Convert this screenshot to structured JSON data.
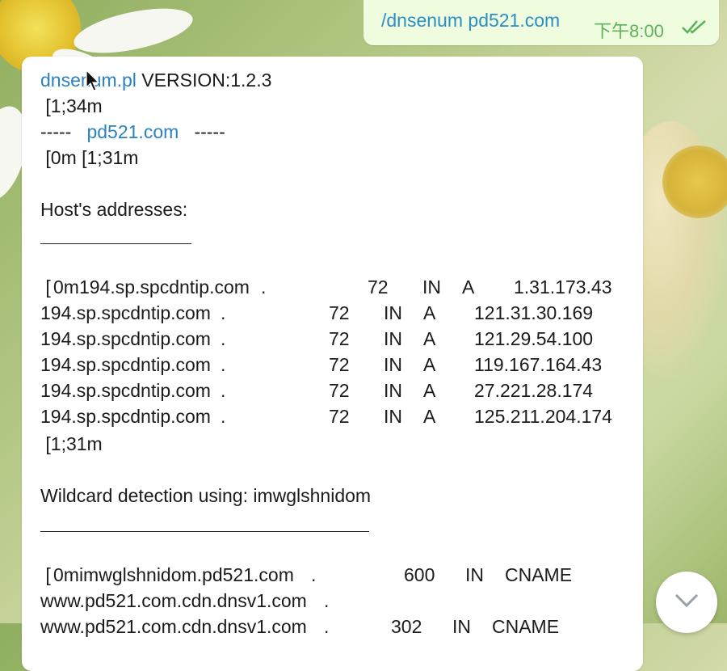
{
  "outgoing": {
    "text": "/dnsenum pd521.com",
    "time": "下午8:00",
    "status_icon": "double-check-icon"
  },
  "incoming": {
    "header_tool": "dnsenum.pl",
    "header_version": " VERSION:1.2.3",
    "line2": " [1;34m",
    "line3_prefix": "-----   ",
    "line3_domain": "pd521.com",
    "line3_suffix": "   -----",
    "line4": " [0m [1;31m",
    "hosts_heading": "Host's addresses:",
    "hosts_rule": "__________________",
    "host_rows": [
      {
        "prefix": " [",
        "host": "0m194.sp.spcdntip.com",
        "dot": ".",
        "ttl": "72",
        "cls": "IN",
        "type": "A",
        "ip": "1.31.173.43"
      },
      {
        "prefix": "",
        "host": "194.sp.spcdntip.com",
        "dot": ".",
        "ttl": "72",
        "cls": "IN",
        "type": "A",
        "ip": "121.31.30.169"
      },
      {
        "prefix": "",
        "host": "194.sp.spcdntip.com",
        "dot": ".",
        "ttl": "72",
        "cls": "IN",
        "type": "A",
        "ip": "121.29.54.100"
      },
      {
        "prefix": "",
        "host": "194.sp.spcdntip.com",
        "dot": ".",
        "ttl": "72",
        "cls": "IN",
        "type": "A",
        "ip": "119.167.164.43"
      },
      {
        "prefix": "",
        "host": "194.sp.spcdntip.com",
        "dot": ".",
        "ttl": "72",
        "cls": "IN",
        "type": "A",
        "ip": "27.221.28.174"
      },
      {
        "prefix": "",
        "host": "194.sp.spcdntip.com",
        "dot": ".",
        "ttl": "72",
        "cls": "IN",
        "type": "A",
        "ip": "125.211.204.174"
      }
    ],
    "after_hosts": " [1;31m",
    "wildcard_heading": "Wildcard detection using: imwglshnidom",
    "wildcard_rule": "_______________________________________",
    "wildcard_rows": [
      {
        "prefix": " [",
        "host": "0mimwglshnidom.pd521.com",
        "dot": ".",
        "ttl": "600",
        "cls": "IN",
        "type": "CNAME"
      },
      {
        "prefix": "",
        "host": "www.pd521.com.cdn.dnsv1.com",
        "dot": "."
      },
      {
        "prefix": "",
        "host": "www.pd521.com.cdn.dnsv1.com",
        "dot": ".",
        "ttl": "302",
        "cls": "IN",
        "type": "CNAME"
      }
    ]
  },
  "scroll_button_icon": "chevron-down-icon",
  "colors": {
    "link": "#2b82c2",
    "outgoing_bubble": "#effdde",
    "outgoing_time": "#5cb25a"
  }
}
